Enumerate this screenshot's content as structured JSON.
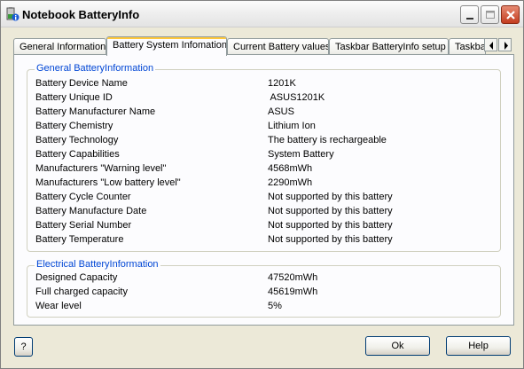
{
  "window": {
    "title": "Notebook BatteryInfo"
  },
  "tabs": [
    {
      "label": "General Information"
    },
    {
      "label": "Battery System Infomation"
    },
    {
      "label": "Current Battery values"
    },
    {
      "label": "Taskbar BatteryInfo setup"
    },
    {
      "label": "Taskba"
    }
  ],
  "general": {
    "title": "General BatteryInformation",
    "rows": [
      {
        "label": "Battery Device Name",
        "value": "1201K"
      },
      {
        "label": "Battery Unique ID",
        "value": " ASUS1201K"
      },
      {
        "label": "Battery Manufacturer Name",
        "value": "ASUS"
      },
      {
        "label": "Battery Chemistry",
        "value": "Lithium Ion"
      },
      {
        "label": "Battery Technology",
        "value": "The battery is rechargeable"
      },
      {
        "label": "Battery Capabilities",
        "value": "System Battery"
      },
      {
        "label": "Manufacturers \"Warning level\"",
        "value": "4568mWh"
      },
      {
        "label": "Manufacturers \"Low battery level\"",
        "value": "2290mWh"
      },
      {
        "label": "Battery Cycle Counter",
        "value": "Not supported by this battery"
      },
      {
        "label": "Battery Manufacture Date",
        "value": "Not supported by this battery"
      },
      {
        "label": "Battery Serial Number",
        "value": "Not supported by this battery"
      },
      {
        "label": "Battery Temperature",
        "value": "Not supported by this battery"
      }
    ]
  },
  "electrical": {
    "title": "Electrical BatteryInformation",
    "rows": [
      {
        "label": "Designed Capacity",
        "value": "47520mWh"
      },
      {
        "label": "Full charged capacity",
        "value": "45619mWh"
      },
      {
        "label": "Wear level",
        "value": "5%"
      }
    ]
  },
  "buttons": {
    "help_q": "?",
    "ok": "Ok",
    "help": "Help"
  }
}
